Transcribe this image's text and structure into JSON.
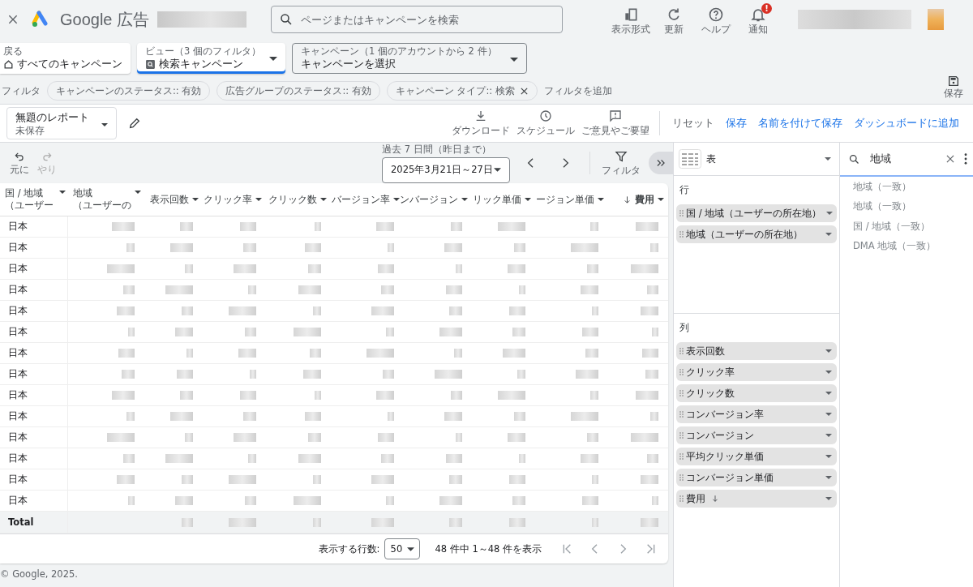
{
  "topbar": {
    "logo_text": "Google 広告",
    "search": {
      "placeholder": "ページまたはキャンペーンを検索"
    },
    "actions": [
      {
        "kind": "format",
        "label": "表示形式"
      },
      {
        "kind": "refresh",
        "label": "更新"
      },
      {
        "kind": "help",
        "label": "ヘルプ"
      },
      {
        "kind": "bell",
        "label": "通知",
        "badge": "!"
      }
    ]
  },
  "nav": {
    "back": {
      "label": "戻る",
      "value": "すべてのキャンペーン"
    },
    "view": {
      "label": "ビュー（3 個のフィルタ）",
      "value": "検索キャンペーン",
      "selected": true
    },
    "campaign": {
      "label": "キャンペーン（1 個のアカウントから 2 件）",
      "value": "キャンペーンを選択",
      "selected": false
    }
  },
  "filters": {
    "label": "フィルタ",
    "chips": [
      {
        "text": "キャンペーンのステータス:: 有効",
        "removable": false
      },
      {
        "text": "広告グループのステータス:: 有効",
        "removable": false
      },
      {
        "text": "キャンペーン タイプ:: 検索",
        "removable": true
      }
    ],
    "add": "フィルタを追加",
    "save": "保存"
  },
  "report": {
    "title": "無題のレポート",
    "subtitle": "未保存",
    "tools": [
      {
        "kind": "download",
        "label": "ダウンロード"
      },
      {
        "kind": "schedule",
        "label": "スケジュール"
      },
      {
        "kind": "feedback",
        "label": "ご意見やご要望"
      }
    ],
    "actions": [
      {
        "label": "リセット",
        "primary": false
      },
      {
        "label": "保存",
        "primary": true
      },
      {
        "label": "名前を付けて保存",
        "primary": true
      },
      {
        "label": "ダッシュボードに追加",
        "primary": true
      }
    ]
  },
  "toolbar": {
    "undo": "元に",
    "redo": "やり",
    "date_label": "過去 7 日間（昨日まで）",
    "date": "2025年3月21日～27日",
    "filter": "フィルタ"
  },
  "table": {
    "columns": [
      {
        "label": "国 / 地域",
        "sub": "（ユーザー",
        "sorted": false
      },
      {
        "label": "地域",
        "sub": "（ユーザーの",
        "sorted": false
      },
      {
        "label": "表示回数",
        "sorted": false
      },
      {
        "label": "クリック率",
        "sorted": false
      },
      {
        "label": "クリック数",
        "sorted": false
      },
      {
        "label": "バージョン率",
        "sorted": false
      },
      {
        "label": "ンバージョン",
        "sorted": false
      },
      {
        "label": "リック単価",
        "sorted": false
      },
      {
        "label": "ージョン単価",
        "sorted": false
      },
      {
        "label": "費用",
        "sorted": true
      }
    ],
    "rows": [
      {
        "country": "日本"
      },
      {
        "country": "日本"
      },
      {
        "country": "日本"
      },
      {
        "country": "日本"
      },
      {
        "country": "日本"
      },
      {
        "country": "日本"
      },
      {
        "country": "日本"
      },
      {
        "country": "日本"
      },
      {
        "country": "日本"
      },
      {
        "country": "日本"
      },
      {
        "country": "日本"
      },
      {
        "country": "日本"
      },
      {
        "country": "日本"
      },
      {
        "country": "日本"
      }
    ],
    "total": "Total",
    "pagination": {
      "rows_label": "表示する行数:",
      "rows_value": "50",
      "range": "48 件中 1～48 件を表示"
    }
  },
  "editor": {
    "chart_type": "表",
    "rows_heading": "行",
    "rows": [
      "国 / 地域（ユーザーの所在地）",
      "地域（ユーザーの所在地）"
    ],
    "columns_heading": "列",
    "columns": [
      {
        "label": "表示回数",
        "sorted": false
      },
      {
        "label": "クリック率",
        "sorted": false
      },
      {
        "label": "クリック数",
        "sorted": false
      },
      {
        "label": "コンバージョン率",
        "sorted": false
      },
      {
        "label": "コンバージョン",
        "sorted": false
      },
      {
        "label": "平均クリック単価",
        "sorted": false
      },
      {
        "label": "コンバージョン単価",
        "sorted": false
      },
      {
        "label": "費用",
        "sorted": true
      }
    ]
  },
  "field_search": {
    "value": "地域",
    "results": [
      "地域（一致）",
      "地域（一致）",
      "国 / 地域（一致）",
      "DMA 地域（一致）"
    ]
  },
  "footer": "© Google, 2025."
}
